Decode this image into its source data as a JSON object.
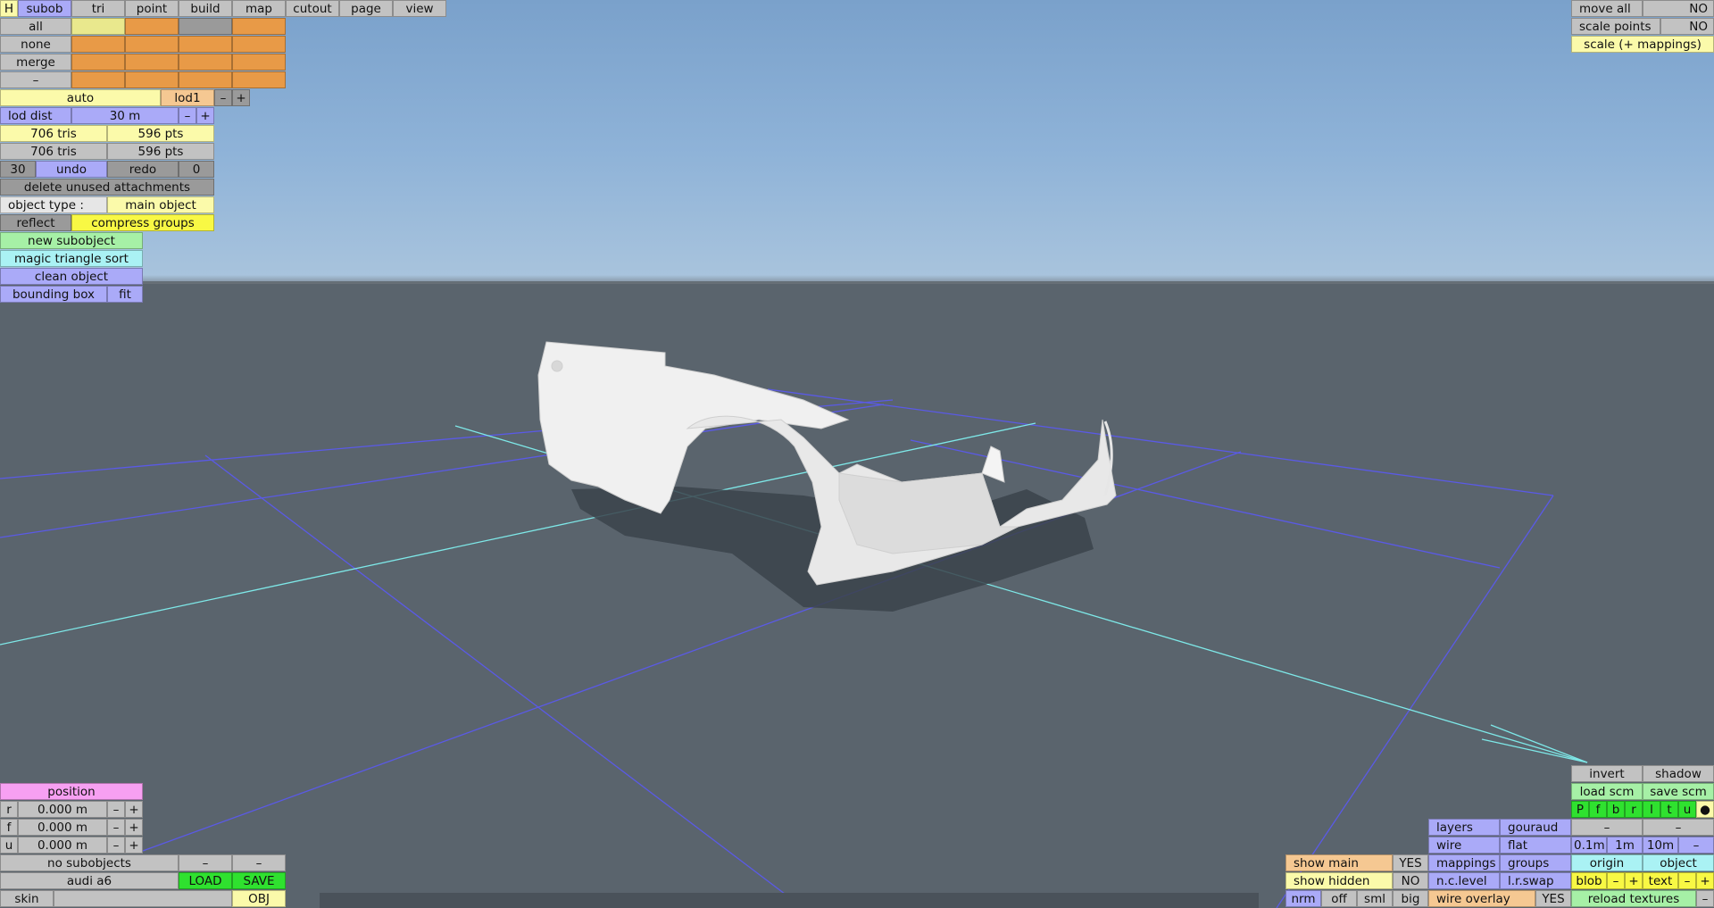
{
  "top_tabs": [
    "H",
    "subob",
    "tri",
    "point",
    "build",
    "map",
    "cutout",
    "page",
    "view"
  ],
  "select_rows": [
    "all",
    "none",
    "merge",
    "–"
  ],
  "lod": {
    "mode": "auto",
    "level": "lod1",
    "minus": "–",
    "plus": "+"
  },
  "lod_dist": {
    "label": "lod dist",
    "value": "30 m",
    "minus": "–",
    "plus": "+"
  },
  "counts": [
    {
      "tris": "706 tris",
      "pts": "596 pts"
    },
    {
      "tris": "706 tris",
      "pts": "596 pts"
    }
  ],
  "undo": {
    "count": "30",
    "undo_label": "undo",
    "redo_label": "redo",
    "redo_count": "0"
  },
  "delete_unused": "delete unused attachments",
  "object_type": {
    "label": "object type :",
    "value": "main object"
  },
  "reflect": "reflect",
  "compress_groups": "compress groups",
  "new_subobject": "new subobject",
  "magic_sort": "magic triangle sort",
  "clean_object": "clean object",
  "bounding_box": {
    "label": "bounding box",
    "fit": "fit"
  },
  "top_right": [
    {
      "label": "move all",
      "value": "NO"
    },
    {
      "label": "scale points",
      "value": "NO"
    }
  ],
  "scale_mappings": "scale (+ mappings)",
  "position": {
    "title": "position",
    "rows": [
      {
        "axis": "r",
        "value": "0.000 m"
      },
      {
        "axis": "f",
        "value": "0.000 m"
      },
      {
        "axis": "u",
        "value": "0.000 m"
      }
    ],
    "minus": "–",
    "plus": "+"
  },
  "bottom_left": {
    "no_subobjects": "no subobjects",
    "minus": "–",
    "model_name": "audi a6",
    "load": "LOAD",
    "save": "SAVE",
    "skin": "skin",
    "obj": "OBJ"
  },
  "bottom_right": {
    "invert": "invert",
    "shadow": "shadow",
    "load_scm": "load scm",
    "save_scm": "save scm",
    "view_buttons": [
      "P",
      "f",
      "b",
      "r",
      "l",
      "t",
      "u",
      "●"
    ],
    "minus": "–",
    "plus": "+",
    "layers": "layers",
    "gouraud": "gouraud",
    "wire": "wire",
    "flat": "flat",
    "grid_steps": [
      "0.1m",
      "1m",
      "10m"
    ],
    "mappings": "mappings",
    "groups": "groups",
    "origin": "origin",
    "object": "object",
    "n_c_level": "n.c.level",
    "l_r_swap": "l.r.swap",
    "blob": "blob",
    "text": "text",
    "show_main": {
      "label": "show main",
      "value": "YES"
    },
    "show_hidden": {
      "label": "show hidden",
      "value": "NO"
    },
    "size_buttons": [
      "nrm",
      "off",
      "sml",
      "big"
    ],
    "wire_overlay": {
      "label": "wire overlay",
      "value": "YES"
    },
    "reload_textures": "reload textures"
  },
  "colors": {
    "sky": "#8fb3d8",
    "ground": "#5a646d",
    "grid_blue": "#5a5ae6",
    "grid_cyan": "#7ee8e8",
    "model": "#f2f2f2",
    "shadow": "#3b434b"
  }
}
